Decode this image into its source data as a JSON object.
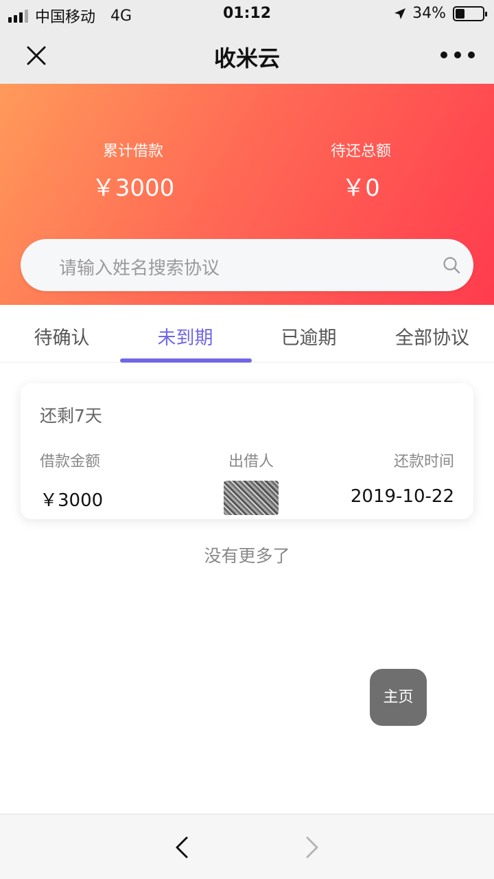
{
  "status_bar": {
    "carrier": "中国移动",
    "network": "4G",
    "time": "01:12",
    "battery_percent_text": "34%",
    "battery_level": 0.34
  },
  "nav": {
    "title": "收米云",
    "icons": [
      "close-icon",
      "more-icon"
    ]
  },
  "summary": {
    "total_borrowed_label": "累计借款",
    "total_borrowed_value": "￥3000",
    "total_due_label": "待还总额",
    "total_due_value": "￥0"
  },
  "search": {
    "placeholder": "请输入姓名搜索协议"
  },
  "tabs": [
    {
      "label": "待确认",
      "active": false
    },
    {
      "label": "未到期",
      "active": true
    },
    {
      "label": "已逾期",
      "active": false
    },
    {
      "label": "全部协议",
      "active": false
    }
  ],
  "colors": {
    "accent": "#7166e6",
    "hero_start": "#ff9a5a",
    "hero_end": "#ff3b4e"
  },
  "agreements": [
    {
      "remaining": "还剩7天",
      "amount_label": "借款金额",
      "amount_value": "￥3000",
      "lender_label": "出借人",
      "repay_time_label": "还款时间",
      "repay_time_value": "2019-10-22"
    }
  ],
  "no_more_text": "没有更多了",
  "home_button_label": "主页"
}
